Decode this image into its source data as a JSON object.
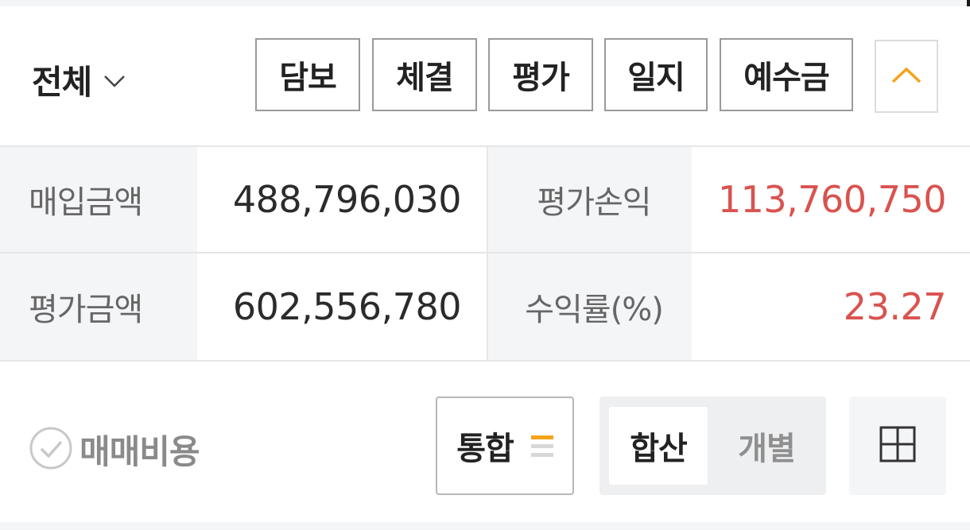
{
  "header": {
    "account_label": "전체",
    "tabs": [
      {
        "label": "담보"
      },
      {
        "label": "체결"
      },
      {
        "label": "평가"
      },
      {
        "label": "일지"
      },
      {
        "label": "예수금"
      }
    ]
  },
  "summary": {
    "purchase_amount_label": "매입금액",
    "purchase_amount_value": "488,796,030",
    "eval_pl_label": "평가손익",
    "eval_pl_value": "113,760,750",
    "eval_amount_label": "평가금액",
    "eval_amount_value": "602,556,780",
    "return_rate_label": "수익률(%)",
    "return_rate_value": "23.27"
  },
  "footer": {
    "fee_label": "매매비용",
    "merge_label": "통합",
    "segment": {
      "active_label": "합산",
      "inactive_label": "개별"
    }
  },
  "colors": {
    "accent_orange": "#f5a31a",
    "profit_red": "#d9534f",
    "label_bg": "#f4f5f7",
    "border": "#9a9a9a"
  },
  "icons": {
    "account_dropdown": "chevron-down-icon",
    "collapse": "chevron-up-icon",
    "fee_toggle": "check-circle-icon",
    "merge_menu": "menu-lines-icon",
    "expand": "plus-square-icon"
  }
}
